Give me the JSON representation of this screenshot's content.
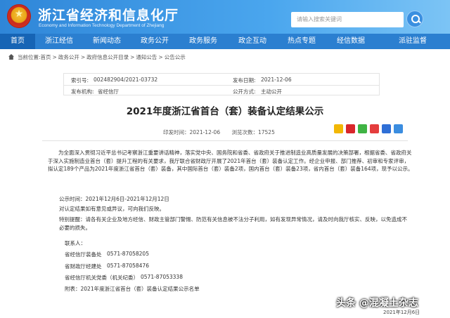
{
  "header": {
    "site_title": "浙江省经济和信息化厅",
    "site_subtitle": "Economy and Information Technology Department of Zhejiang",
    "search_placeholder": "请输入搜索关键词"
  },
  "nav": {
    "items": [
      {
        "label": "首页",
        "width": 50
      },
      {
        "label": "浙江经信",
        "width": 68
      },
      {
        "label": "新闻动态",
        "width": 68
      },
      {
        "label": "政务公开",
        "width": 68
      },
      {
        "label": "政务服务",
        "width": 70
      },
      {
        "label": "政企互动",
        "width": 70
      },
      {
        "label": "热点专题",
        "width": 70
      },
      {
        "label": "经信数据",
        "width": 70
      },
      {
        "label": "派驻监督",
        "width": 106
      }
    ]
  },
  "breadcrumb": {
    "prefix": "当前位置:",
    "items": [
      "首页",
      "政务公开",
      "政府信息公开目录",
      "通知公告",
      "公告公示"
    ],
    "separator": ">"
  },
  "meta": {
    "index_label": "索引号:",
    "index_value": "002482904/2021-03732",
    "date_label": "发布日期:",
    "date_value": "2021-12-06",
    "org_label": "发布机构:",
    "org_value": "省经信厅",
    "mode_label": "公开方式:",
    "mode_value": "主动公开"
  },
  "article": {
    "title": "2021年度浙江省首台（套）装备认定结果公示",
    "print_label": "印发时间：",
    "print_date": "2021-12-06",
    "views_label": "浏览次数：",
    "views": "17525",
    "para1": "为全面深入贯彻习近平总书记考察浙江重要讲话精神，落实党中央、国务院和省委、省政府关于推进制造业高质量发展的决策部署，根据省委、省政府关于深入实施制造业首台（套）提升工程的有关要求，我厅联合省财政厅开展了2021年首台（套）装备认定工作。经企业申报、部门推荐、初审和专家评审，拟认定189个产品为2021年度浙江省首台（套）装备，其中国际首台（套）装备2项，国内首台（套）装备23项，省内首台（套）装备164项，现予以公示。",
    "period": "公示时间：2021年12月6日-2021年12月12日",
    "objection": "对认定结果如有意见或异议，可向我们反映。",
    "notice": "特别提醒：请各有关企业及地方经信、财政主管部门警惕、防范有关信息被不法分子利用，如有发现异常情况，请及时向我厅核实、反映，以免造成不必要的损失。",
    "contact_label": "联系人：",
    "contacts": [
      {
        "org": "省经信厅装备处",
        "phone": "0571-87058205"
      },
      {
        "org": "省财政厅经建处",
        "phone": "0571-87058476"
      },
      {
        "org": "省经信厅机关党委（机关纪委）",
        "phone": "0571-87053338"
      }
    ],
    "attachment": "附表：2021年度浙江省首台（套）装备认定结果公示名单"
  },
  "watermark": {
    "text": "头条 @混凝土杂志",
    "date": "2021年12月6日"
  },
  "colors": {
    "header_blue": "#2f86d8",
    "nav_blue": "#2b7fd0",
    "nav_active": "#1664b5"
  }
}
